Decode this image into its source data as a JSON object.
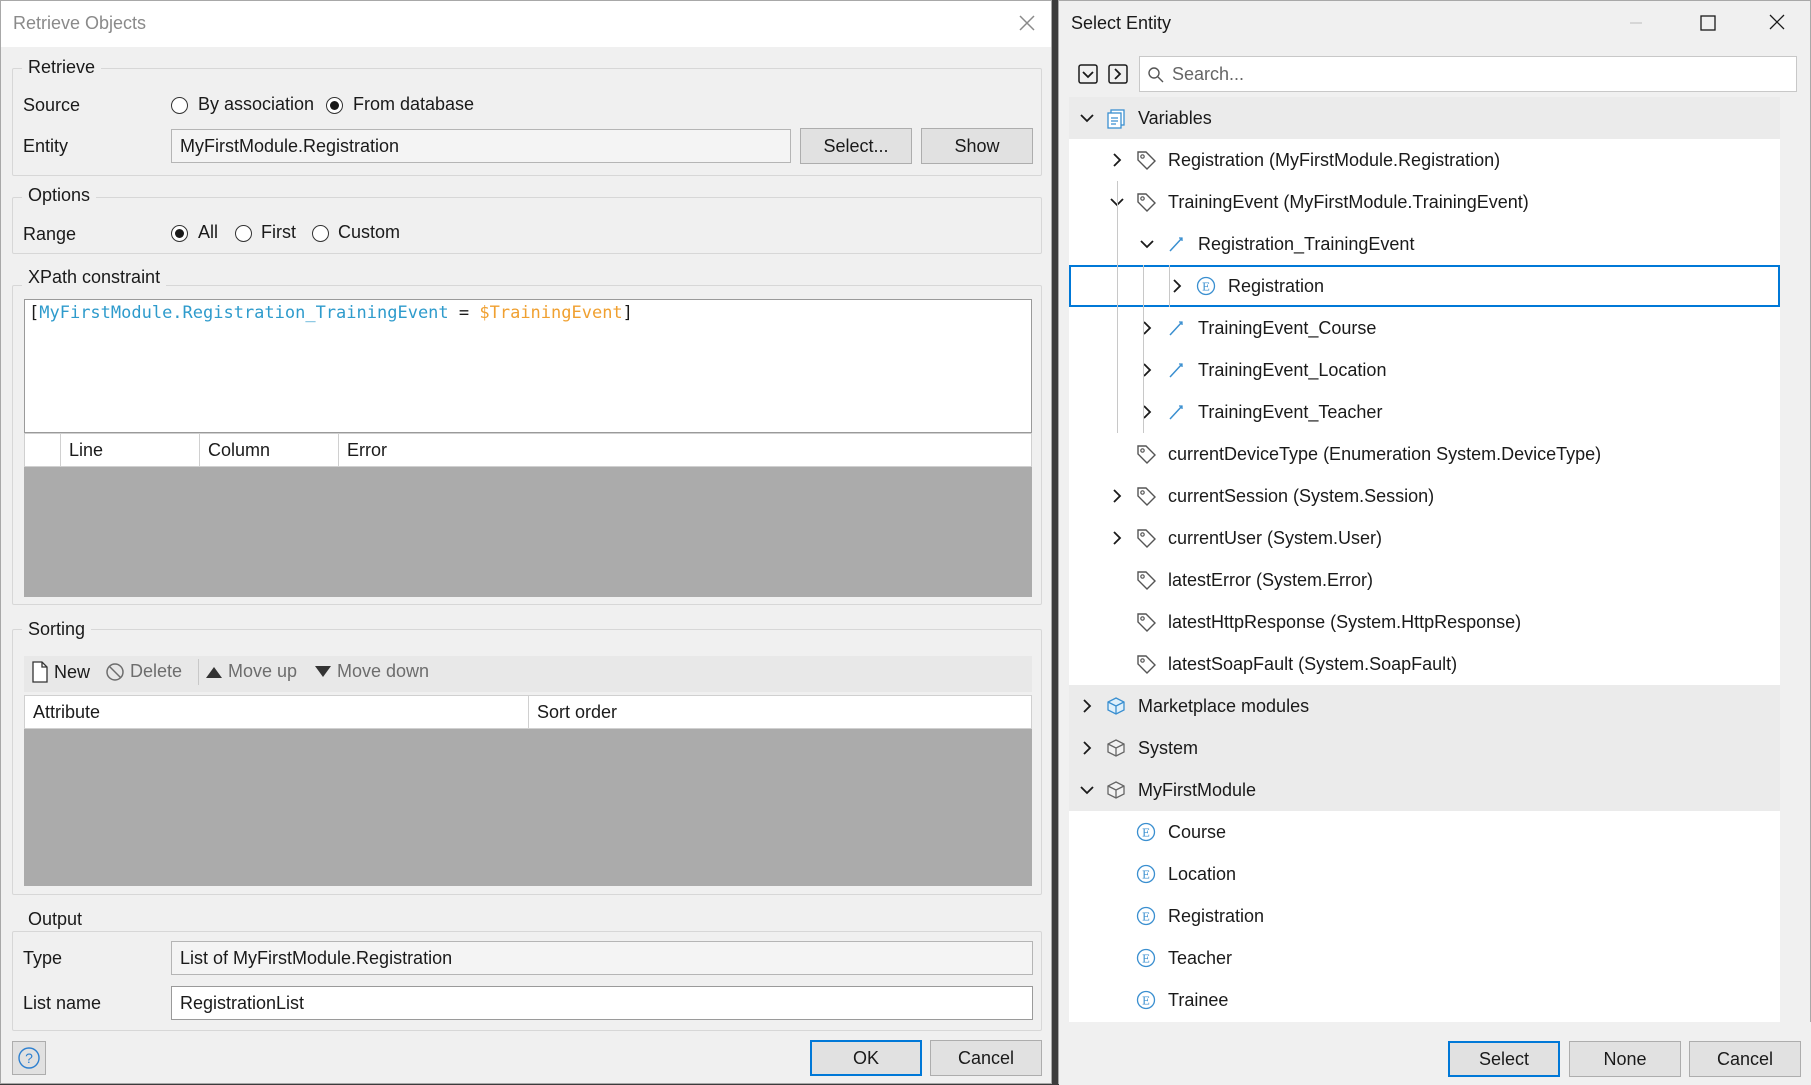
{
  "left": {
    "title": "Retrieve Objects",
    "retrieve": {
      "group": "Retrieve",
      "source_label": "Source",
      "source_options": [
        "By association",
        "From database"
      ],
      "source_selected": "From database",
      "entity_label": "Entity",
      "entity_value": "MyFirstModule.Registration",
      "select_button": "Select...",
      "show_button": "Show"
    },
    "options": {
      "group": "Options",
      "range_label": "Range",
      "range_options": [
        "All",
        "First",
        "Custom"
      ],
      "range_selected": "All"
    },
    "xpath": {
      "group": "XPath constraint",
      "open_bracket": "[",
      "attribute": "MyFirstModule.Registration_TrainingEvent",
      "operator": " = ",
      "variable": "$TrainingEvent",
      "close_bracket": "]",
      "attribute_color": "#2e9bcc",
      "variable_color": "#f0a030",
      "columns": [
        "Line",
        "Column",
        "Error"
      ]
    },
    "sorting": {
      "group": "Sorting",
      "new_label": "New",
      "delete_label": "Delete",
      "move_up_label": "Move up",
      "move_down_label": "Move down",
      "columns": [
        "Attribute",
        "Sort order"
      ]
    },
    "output": {
      "group": "Output",
      "type_label": "Type",
      "type_value": "List of MyFirstModule.Registration",
      "list_name_label": "List name",
      "list_name_value": "RegistrationList"
    },
    "ok_button": "OK",
    "cancel_button": "Cancel"
  },
  "right": {
    "title": "Select Entity",
    "search_placeholder": "Search...",
    "tree": [
      {
        "label": "Variables",
        "level": 0,
        "icon": "variables-icon",
        "expanded": true,
        "section": true
      },
      {
        "label": "Registration (MyFirstModule.Registration)",
        "level": 1,
        "icon": "tag-icon",
        "expanded": false
      },
      {
        "label": "TrainingEvent (MyFirstModule.TrainingEvent)",
        "level": 1,
        "icon": "tag-icon",
        "expanded": true
      },
      {
        "label": "Registration_TrainingEvent",
        "level": 2,
        "icon": "association-icon",
        "expanded": true
      },
      {
        "label": "Registration",
        "level": 3,
        "icon": "entity-icon",
        "expanded": false,
        "selected": true
      },
      {
        "label": "TrainingEvent_Course",
        "level": 2,
        "icon": "association-icon",
        "expanded": false
      },
      {
        "label": "TrainingEvent_Location",
        "level": 2,
        "icon": "association-icon",
        "expanded": false
      },
      {
        "label": "TrainingEvent_Teacher",
        "level": 2,
        "icon": "association-icon",
        "expanded": false
      },
      {
        "label": "currentDeviceType (Enumeration System.DeviceType)",
        "level": 1,
        "icon": "tag-icon",
        "expanded": null
      },
      {
        "label": "currentSession (System.Session)",
        "level": 1,
        "icon": "tag-icon",
        "expanded": false
      },
      {
        "label": "currentUser (System.User)",
        "level": 1,
        "icon": "tag-icon",
        "expanded": false
      },
      {
        "label": "latestError (System.Error)",
        "level": 1,
        "icon": "tag-icon",
        "expanded": null
      },
      {
        "label": "latestHttpResponse (System.HttpResponse)",
        "level": 1,
        "icon": "tag-icon",
        "expanded": null
      },
      {
        "label": "latestSoapFault (System.SoapFault)",
        "level": 1,
        "icon": "tag-icon",
        "expanded": null
      },
      {
        "label": "Marketplace modules",
        "level": 0,
        "icon": "marketplace-module-icon",
        "expanded": false,
        "section": true
      },
      {
        "label": "System",
        "level": 0,
        "icon": "module-icon",
        "expanded": false,
        "section": true
      },
      {
        "label": "MyFirstModule",
        "level": 0,
        "icon": "module-icon",
        "expanded": true,
        "section": true
      },
      {
        "label": "Course",
        "level": 1,
        "icon": "entity-icon",
        "expanded": null
      },
      {
        "label": "Location",
        "level": 1,
        "icon": "entity-icon",
        "expanded": null
      },
      {
        "label": "Registration",
        "level": 1,
        "icon": "entity-icon",
        "expanded": null
      },
      {
        "label": "Teacher",
        "level": 1,
        "icon": "entity-icon",
        "expanded": null
      },
      {
        "label": "Trainee",
        "level": 1,
        "icon": "entity-icon",
        "expanded": null
      }
    ],
    "select_button": "Select",
    "none_button": "None",
    "cancel_button": "Cancel"
  }
}
